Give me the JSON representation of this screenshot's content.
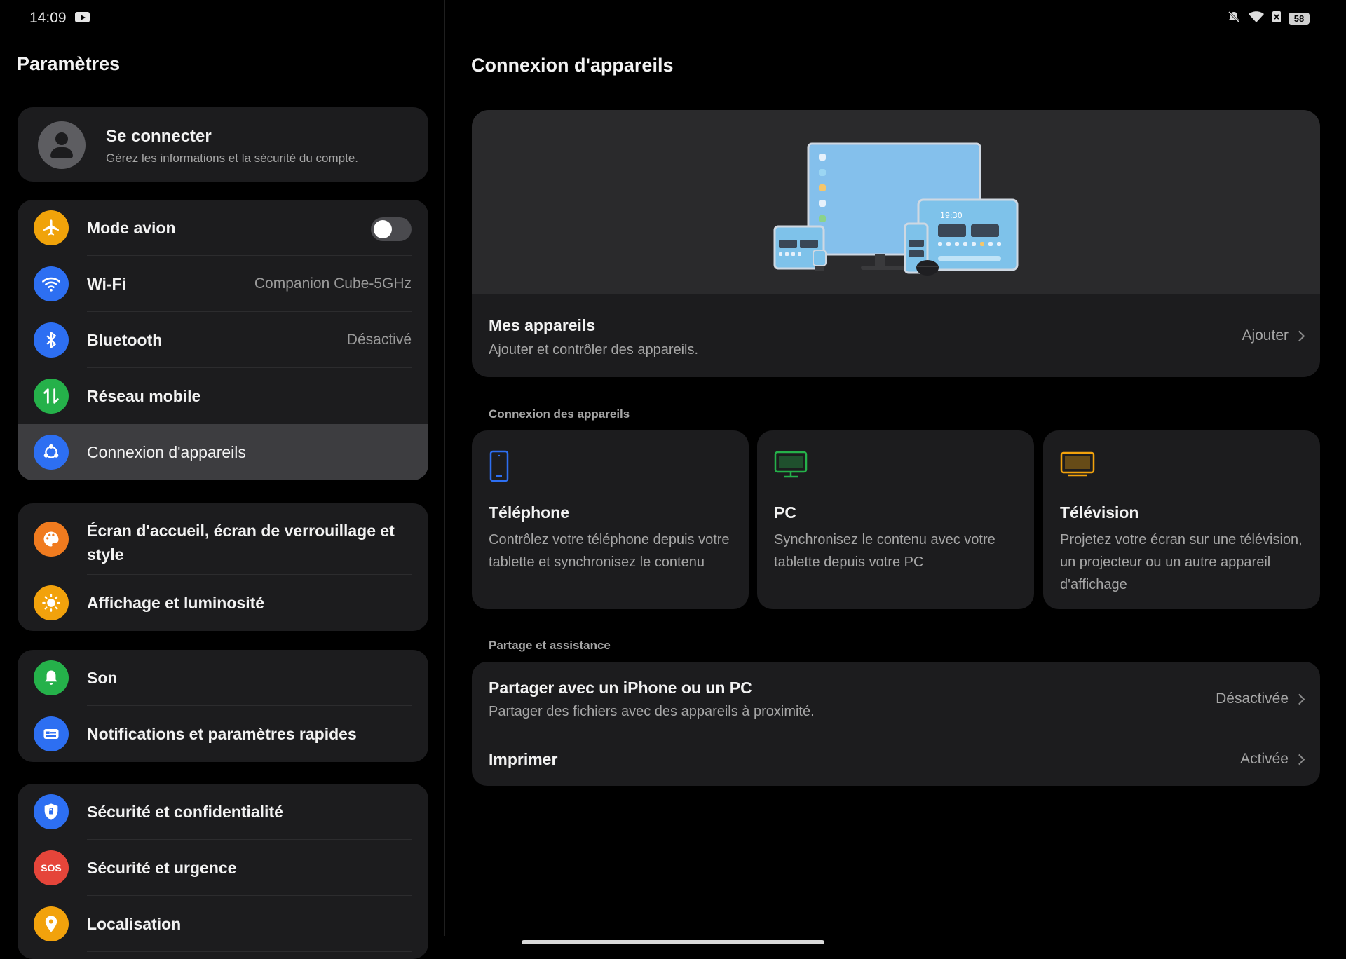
{
  "status": {
    "time": "14:09",
    "battery": "58"
  },
  "left": {
    "title": "Paramètres",
    "account": {
      "title": "Se connecter",
      "subtitle": "Gérez les informations et la sécurité du compte."
    },
    "items": [
      {
        "label": "Mode avion",
        "icon": "airplane-icon",
        "color": "#f0a30a",
        "toggle": false
      },
      {
        "label": "Wi-Fi",
        "value": "Companion Cube-5GHz",
        "icon": "wifi-icon",
        "color": "#2d6ff2"
      },
      {
        "label": "Bluetooth",
        "value": "Désactivé",
        "icon": "bluetooth-icon",
        "color": "#2d6ff2"
      },
      {
        "label": "Réseau mobile",
        "icon": "mobile-data-icon",
        "color": "#25b14a"
      },
      {
        "label": "Connexion d'appareils",
        "icon": "device-connection-icon",
        "color": "#2d6ff2",
        "selected": true
      },
      {
        "label": "Écran d'accueil, écran de verrouillage et style",
        "icon": "palette-icon",
        "color": "#f07b1f"
      },
      {
        "label": "Affichage et luminosité",
        "icon": "brightness-icon",
        "color": "#f2a20c"
      },
      {
        "label": "Son",
        "icon": "bell-icon",
        "color": "#25b14a"
      },
      {
        "label": "Notifications et paramètres rapides",
        "icon": "notification-icon",
        "color": "#2d6ff2"
      },
      {
        "label": "Sécurité et confidentialité",
        "icon": "shield-icon",
        "color": "#2d6ff2"
      },
      {
        "label": "Sécurité et urgence",
        "icon": "sos-icon",
        "color": "#e5453a",
        "badge": "SOS"
      },
      {
        "label": "Localisation",
        "icon": "location-icon",
        "color": "#f2a20c"
      }
    ]
  },
  "right": {
    "title": "Connexion d'appareils",
    "hero": {
      "title": "Mes appareils",
      "subtitle": "Ajouter et contrôler des appareils.",
      "action": "Ajouter",
      "illustration_time": "19:30"
    },
    "section_devices": "Connexion des appareils",
    "devices": [
      {
        "title": "Téléphone",
        "desc": "Contrôlez votre téléphone depuis votre tablette et synchronisez le contenu",
        "icon": "phone-icon",
        "color": "#2d6ff2"
      },
      {
        "title": "PC",
        "desc": "Synchronisez le contenu avec votre tablette depuis votre PC",
        "icon": "monitor-icon",
        "color": "#25b14a"
      },
      {
        "title": "Télévision",
        "desc": "Projetez votre écran sur une télévision, un projecteur ou un autre appareil d'affichage",
        "icon": "tv-icon",
        "color": "#f2a20c"
      }
    ],
    "section_share": "Partage et assistance",
    "share": [
      {
        "title": "Partager avec un iPhone ou un PC",
        "subtitle": "Partager des fichiers avec des appareils à proximité.",
        "value": "Désactivée"
      },
      {
        "title": "Imprimer",
        "value": "Activée"
      }
    ]
  }
}
